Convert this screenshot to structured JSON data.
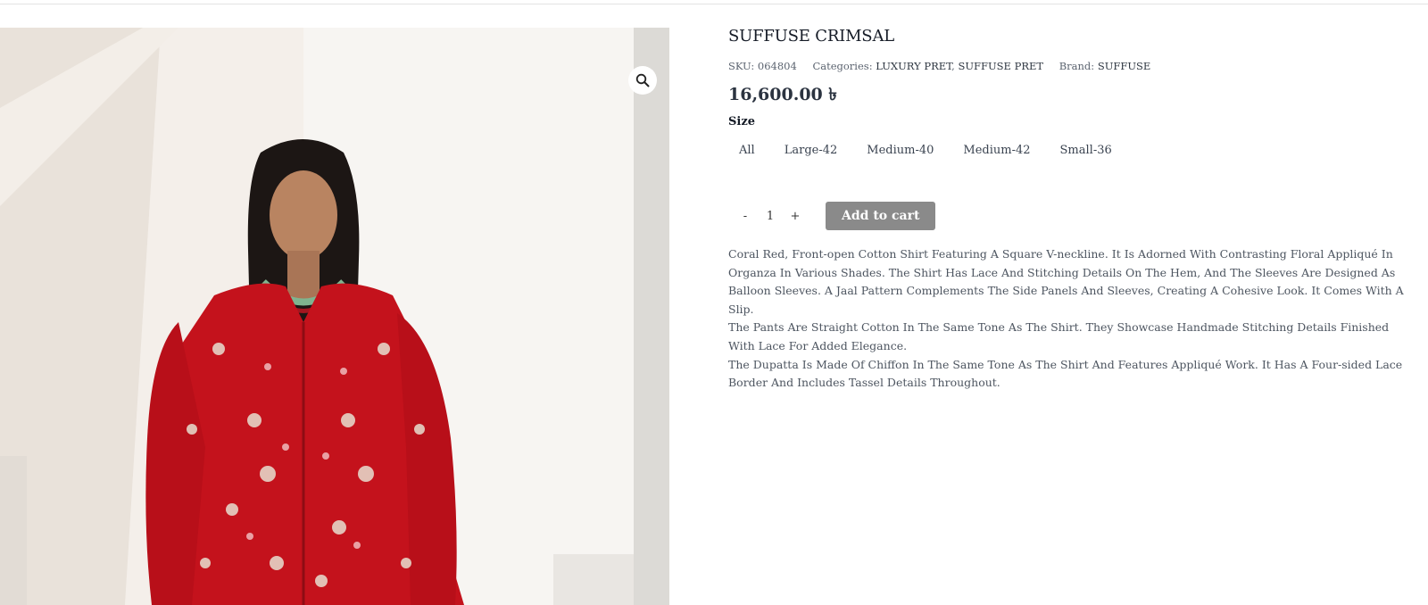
{
  "product": {
    "title": "SUFFUSE CRIMSAL",
    "sku_label": "SKU:",
    "sku": "064804",
    "categories_label": "Categories:",
    "categories": [
      "LUXURY PRET",
      "SUFFUSE PRET"
    ],
    "brand_label": "Brand:",
    "brand": "SUFFUSE",
    "price": "16,600.00 ৳",
    "size_label": "Size",
    "sizes": [
      "All",
      "Large-42",
      "Medium-40",
      "Medium-42",
      "Small-36"
    ],
    "quantity": {
      "minus": "-",
      "value": "1",
      "plus": "+"
    },
    "add_to_cart_label": "Add to cart",
    "description": [
      "Coral Red, Front-open Cotton Shirt Featuring A Square V-neckline. It Is Adorned With Contrasting Floral Appliqué In Organza In Various Shades. The Shirt Has Lace And Stitching Details On The Hem, And The Sleeves Are Designed As Balloon Sleeves. A Jaal Pattern Complements The Side Panels And Sleeves, Creating A Cohesive Look. It Comes With A Slip.",
      "The Pants Are Straight Cotton In The Same Tone As The Shirt. They Showcase Handmade Stitching Details Finished With Lace For Added Elegance.",
      "The Dupatta Is Made Of Chiffon In The Same Tone As The Shirt And Features Appliqué Work. It Has A Four-sided Lace Border And Includes Tassel Details Throughout."
    ]
  },
  "gallery": {
    "zoom_icon": "magnifier-icon",
    "image_subject": "model-in-red-embroidered-dress"
  },
  "colors": {
    "button_bg": "#8a8a8a",
    "dress_red": "#c4121c",
    "text_dark": "#151b26"
  }
}
